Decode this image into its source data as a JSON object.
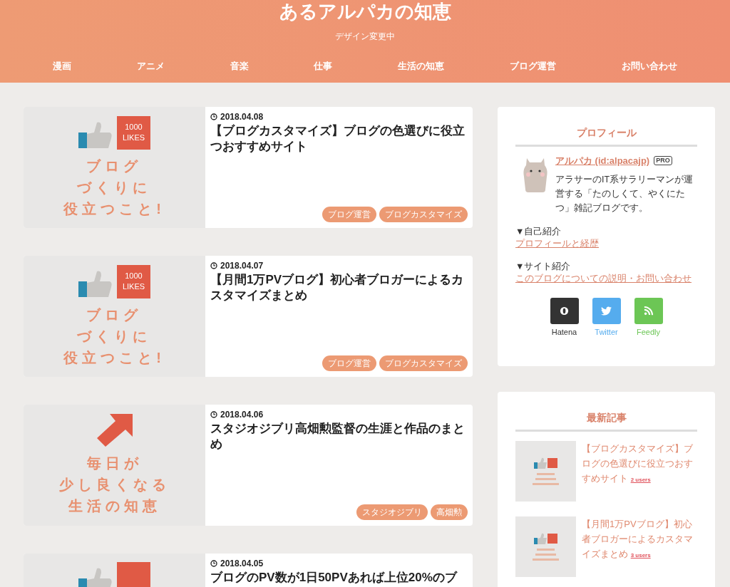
{
  "site": {
    "title": "あるアルパカの知恵",
    "subtitle": "デザイン変更中"
  },
  "nav": [
    "漫画",
    "アニメ",
    "音楽",
    "仕事",
    "生活の知恵",
    "ブログ運営",
    "お問い合わせ"
  ],
  "posts": [
    {
      "date": "2018.04.08",
      "title": "【ブログカスタマイズ】ブログの色選びに役立つおすすめサイト",
      "tags": [
        "ブログ運営",
        "ブログカスタマイズ"
      ],
      "thumbnail": {
        "kind": "likes",
        "badge": "1000 LIKES",
        "lines": [
          "ブログ",
          "づくりに",
          "役立つこと!"
        ]
      }
    },
    {
      "date": "2018.04.07",
      "title": "【月間1万PVブログ】初心者ブロガーによるカスタマイズまとめ",
      "tags": [
        "ブログ運営",
        "ブログカスタマイズ"
      ],
      "thumbnail": {
        "kind": "likes",
        "badge": "1000 LIKES",
        "lines": [
          "ブログ",
          "づくりに",
          "役立つこと!"
        ]
      }
    },
    {
      "date": "2018.04.06",
      "title": "スタジオジブリ高畑勲監督の生涯と作品のまとめ",
      "tags": [
        "スタジオジブリ",
        "高畑勲"
      ],
      "thumbnail": {
        "kind": "arrow",
        "lines": [
          "毎日が",
          "少し良くなる",
          "生活の知恵"
        ]
      }
    },
    {
      "date": "2018.04.05",
      "title": "ブログのPV数が1日50PVあれば上位20%のブ",
      "thumbnail": {
        "kind": "likes"
      }
    }
  ],
  "sidebar": {
    "profile": {
      "heading": "プロフィール",
      "name": "アルパカ (id:alpacajp)",
      "badge": "PRO",
      "description": "アラサーのIT系サラリーマンが運営する「たのしくて、やくにたつ」雑記ブログです。",
      "sections": [
        {
          "label": "▼自己紹介",
          "link": "プロフィールと経歴"
        },
        {
          "label": "▼サイト紹介",
          "link": "このブログについての説明・お問い合わせ"
        }
      ],
      "social": [
        {
          "kind": "hatena",
          "label": "Hatena",
          "color": "#333333"
        },
        {
          "kind": "twitter",
          "label": "Twitter",
          "color": "#55acee"
        },
        {
          "kind": "feedly",
          "label": "Feedly",
          "color": "#6cc655"
        }
      ]
    },
    "recent": {
      "heading": "最新記事",
      "items": [
        {
          "title": "【ブログカスタマイズ】ブログの色選びに役立つおすすめサイト",
          "users": "2 users"
        },
        {
          "title": "【月間1万PVブログ】初心者ブロガーによるカスタマイズまとめ",
          "users": "3 users"
        }
      ]
    }
  }
}
